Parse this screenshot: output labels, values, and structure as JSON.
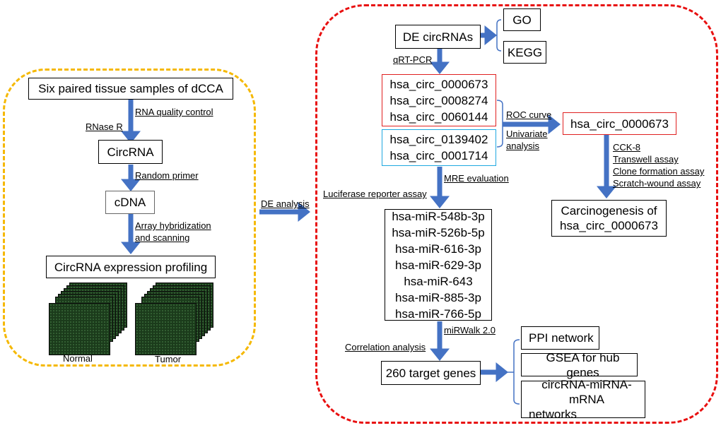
{
  "colors": {
    "yellow_region": "#f5b800",
    "red_region": "#e81010",
    "arrow": "#4472c4",
    "red_box": "#e02020",
    "cyan_box": "#1fa8e0"
  },
  "left": {
    "samples": "Six paired tissue samples of dCCA",
    "step1_label_right": "RNA quality control",
    "step1_label_left": "RNase R",
    "circrna": "CircRNA",
    "step2_label": "Random primer",
    "cdna": "cDNA",
    "step3_label_line1": "Array hybridization",
    "step3_label_line2": "and scanning",
    "profiling": "CircRNA expression profiling",
    "normal_caption": "Normal",
    "tumor_caption": "Tumor"
  },
  "middle": {
    "de_analysis": "DE analysis"
  },
  "right": {
    "de_circrnas": "DE circRNAs",
    "go": "GO",
    "kegg": "KEGG",
    "qrtpcr": "qRT-PCR",
    "red_group": [
      "hsa_circ_0000673",
      "hsa_circ_0008274",
      "hsa_circ_0060144"
    ],
    "cyan_group": [
      "hsa_circ_0139402",
      "hsa_circ_0001714"
    ],
    "roc_curve": "ROC curve",
    "univariate_line1": "Univariate",
    "univariate_line2": "analysis",
    "selected_circ": "hsa_circ_0000673",
    "assays": [
      "CCK-8",
      "Transwell assay",
      "Clone formation assay",
      "Scratch-wound assay"
    ],
    "carcinogenesis_line1": "Carcinogenesis of",
    "carcinogenesis_line2": "hsa_circ_0000673",
    "mre_evaluation": "MRE evaluation",
    "luciferase": "Luciferase reporter assay",
    "mirnas": [
      "hsa-miR-548b-3p",
      "hsa-miR-526b-5p",
      "hsa-miR-616-3p",
      "hsa-miR-629-3p",
      "hsa-miR-643",
      "hsa-miR-885-3p",
      "hsa-miR-766-5p"
    ],
    "mirwalk": "miRWalk 2.0",
    "correlation": "Correlation analysis",
    "target_genes": "260 target genes",
    "ppi": "PPI network",
    "gsea": "GSEA for hub genes",
    "network_line1": "circRNA-miRNA-mRNA",
    "network_line2": "networks"
  }
}
